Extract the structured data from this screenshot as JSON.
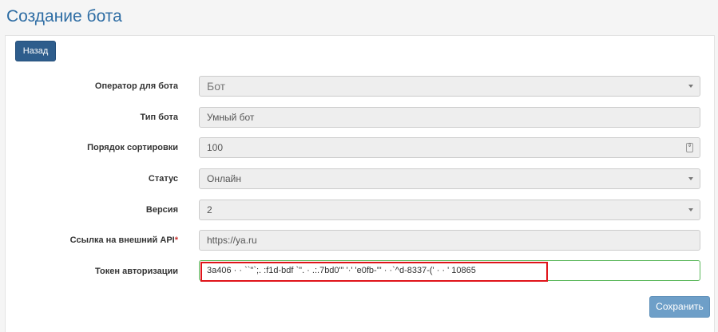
{
  "page": {
    "title": "Создание бота"
  },
  "actions": {
    "back_label": "Назад",
    "save_label": "Сохранить"
  },
  "form": {
    "operator": {
      "label": "Оператор для бота",
      "value": "Бот"
    },
    "type": {
      "label": "Тип бота",
      "value": "Умный бот"
    },
    "sort_order": {
      "label": "Порядок сортировки",
      "value": "100",
      "spinner": "⇕"
    },
    "status": {
      "label": "Статус",
      "value": "Онлайн"
    },
    "version": {
      "label": "Версия",
      "value": "2"
    },
    "api_link": {
      "label": "Ссылка на внешний API",
      "required_mark": "*",
      "value": "https://ya.ru"
    },
    "token": {
      "label": "Токен авторизации",
      "value": "3a406 · · ``\"`;. :f1d-bdf `\". · .:.7bd0'\" '·' 'e0fb-'\" · ·`^d-8337-(' · · ' 10865"
    }
  },
  "colors": {
    "title": "#2e6da4",
    "back_button": "#2e5d8c",
    "save_button": "#6e9fc8",
    "token_border": "#5cb85c",
    "highlight": "#e0141a"
  }
}
